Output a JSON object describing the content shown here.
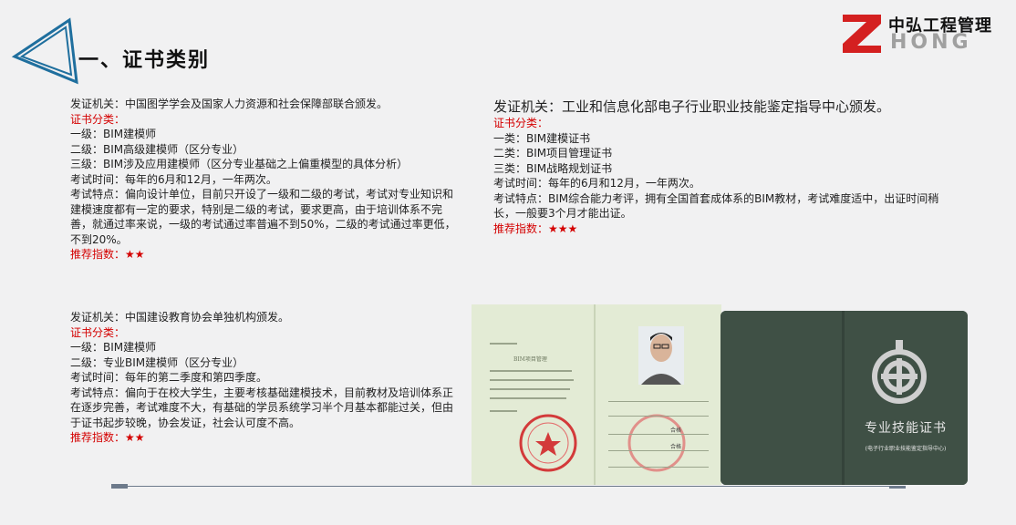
{
  "header": {
    "title": "一、证书类别",
    "logo": {
      "cn_text": "中弘工程管理",
      "en_text": "HONG"
    }
  },
  "blocks": [
    {
      "issuer": "发证机关：中国图学学会及国家人力资源和社会保障部联合颁发。",
      "category_label": "证书分类：",
      "levels": [
        "一级：BIM建模师",
        "二级：BIM高级建模师（区分专业）",
        "三级：BIM涉及应用建模师（区分专业基础之上偏重模型的具体分析）"
      ],
      "exam_time": "考试时间：每年的6月和12月，一年两次。",
      "features": "考试特点：偏向设计单位，目前只开设了一级和二级的考试，考试对专业知识和建模速度都有一定的要求，特别是二级的考试，要求更高，由于培训体系不完善，就通过率来说，一级的考试通过率普遍不到50%，二级的考试通过率更低，不到20%。",
      "recommend": "推荐指数：★★"
    },
    {
      "issuer": "发证机关：工业和信息化部电子行业职业技能鉴定指导中心颁发。",
      "category_label": "证书分类：",
      "levels": [
        "一类：BIM建模证书",
        "二类：BIM项目管理证书",
        "三类：BIM战略规划证书"
      ],
      "exam_time": "考试时间：每年的6月和12月，一年两次。",
      "features": "考试特点：BIM综合能力考评，拥有全国首套成体系的BIM教材，考试难度适中，出证时间稍长，一般要3个月才能出证。",
      "recommend": "推荐指数：★★★"
    },
    {
      "issuer": "发证机关：中国建设教育协会单独机构颁发。",
      "category_label": "证书分类：",
      "levels": [
        "一级：BIM建模师",
        "二级：专业BIM建模师（区分专业）"
      ],
      "exam_time": "考试时间：每年的第二季度和第四季度。",
      "features": "考试特点：偏向于在校大学生，主要考核基础建模技术，目前教材及培训体系正在逐步完善，考试难度不大，有基础的学员系统学习半个月基本都能过关，但由于证书起步较晚，协会发证，社会认可度不高。",
      "recommend": "推荐指数：★★"
    }
  ],
  "certificate": {
    "inner_heading": "BIM项目管理",
    "pass_text": "合格",
    "cover_title": "专业技能证书",
    "cover_subtitle": "(电子行业职业技能鉴定指导中心)"
  },
  "colors": {
    "accent_blue": "#1f6f9e",
    "red": "#d40000",
    "logo_red": "#d42020",
    "cover_green": "#3f5045"
  }
}
